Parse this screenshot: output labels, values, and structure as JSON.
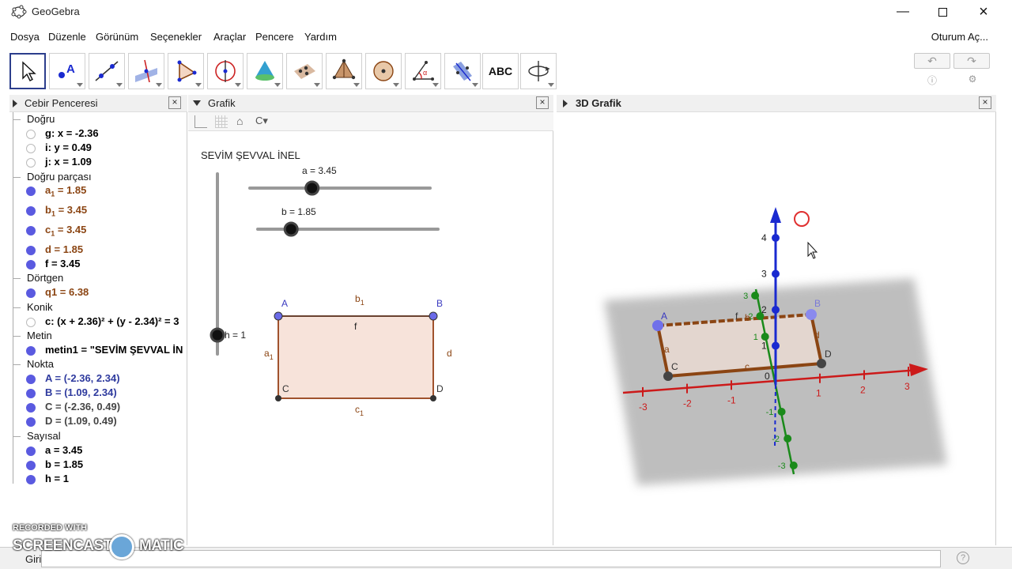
{
  "window": {
    "title": "GeoGebra",
    "min_icon": "minimize-icon",
    "max_icon": "maximize-icon",
    "close_icon": "close-icon"
  },
  "menu": {
    "items": [
      "Dosya",
      "Düzenle",
      "Görünüm",
      "Seçenekler",
      "Araçlar",
      "Pencere",
      "Yardım"
    ],
    "login": "Oturum Aç..."
  },
  "toolbar": {
    "tools": [
      "move-tool-icon",
      "point-tool-icon",
      "line-tool-icon",
      "perpendicular-tool-icon",
      "polygon-tool-icon",
      "circle-tool-icon",
      "cone-tool-icon",
      "plane-tool-icon",
      "pyramid-tool-icon",
      "sphere-tool-icon",
      "angle-tool-icon",
      "reflect-tool-icon",
      "text-tool-icon",
      "rotate-view-tool-icon"
    ],
    "text_tool_label": "ABC",
    "undo_icon": "undo-icon",
    "redo_icon": "redo-icon",
    "help_icon": "help-icon",
    "settings_icon": "gear-icon"
  },
  "algebra": {
    "title": "Cebir Penceresi",
    "rows": [
      {
        "type": "cat",
        "text": "Doğru"
      },
      {
        "type": "item",
        "text": "g: x = -2.36",
        "shown": false,
        "color": "#000000"
      },
      {
        "type": "item",
        "text": "i: y = 0.49",
        "shown": false,
        "color": "#000000"
      },
      {
        "type": "item",
        "text": "j: x = 1.09",
        "shown": false,
        "color": "#000000"
      },
      {
        "type": "cat",
        "text": "Doğru parçası"
      },
      {
        "type": "item",
        "name": "a",
        "sub": "1",
        "rest": " = 1.85",
        "shown": true,
        "color": "#8b4513"
      },
      {
        "type": "item",
        "name": "b",
        "sub": "1",
        "rest": " = 3.45",
        "shown": true,
        "color": "#8b4513"
      },
      {
        "type": "item",
        "name": "c",
        "sub": "1",
        "rest": " = 3.45",
        "shown": true,
        "color": "#8b4513"
      },
      {
        "type": "item",
        "text": "d = 1.85",
        "shown": true,
        "color": "#8b4513"
      },
      {
        "type": "item",
        "text": "f = 3.45",
        "shown": true,
        "color": "#000000"
      },
      {
        "type": "cat",
        "text": "Dörtgen"
      },
      {
        "type": "item",
        "text": "q1 = 6.38",
        "shown": true,
        "color": "#8b4513"
      },
      {
        "type": "cat",
        "text": "Konik"
      },
      {
        "type": "item",
        "text": "c: (x + 2.36)² + (y - 2.34)² = 3",
        "shown": false,
        "color": "#000000"
      },
      {
        "type": "cat",
        "text": "Metin"
      },
      {
        "type": "item",
        "text": "metin1 = \"SEVİM ŞEVVAL İN",
        "shown": true,
        "color": "#000000"
      },
      {
        "type": "cat",
        "text": "Nokta"
      },
      {
        "type": "item",
        "text": "A = (-2.36, 2.34)",
        "shown": true,
        "color": "#2e3a9e"
      },
      {
        "type": "item",
        "text": "B = (1.09, 2.34)",
        "shown": true,
        "color": "#2e3a9e"
      },
      {
        "type": "item",
        "text": "C = (-2.36, 0.49)",
        "shown": true,
        "color": "#444444"
      },
      {
        "type": "item",
        "text": "D = (1.09, 0.49)",
        "shown": true,
        "color": "#444444"
      },
      {
        "type": "cat",
        "text": "Sayısal"
      },
      {
        "type": "item",
        "text": "a = 3.45",
        "shown": true,
        "color": "#000000"
      },
      {
        "type": "item",
        "text": "b = 1.85",
        "shown": true,
        "color": "#000000"
      },
      {
        "type": "item",
        "text": "h = 1",
        "shown": true,
        "color": "#000000"
      }
    ]
  },
  "graphics": {
    "title": "Grafik",
    "text_label": "SEVİM ŞEVVAL İNEL",
    "slider_a": {
      "label": "a = 3.45",
      "value": 3.45,
      "min": 0,
      "max": 10
    },
    "slider_b": {
      "label": "b = 1.85",
      "value": 1.85,
      "min": 0,
      "max": 10
    },
    "slider_h": {
      "label": "h = 1",
      "value": 1
    },
    "points": {
      "A": "A",
      "B": "B",
      "C": "C",
      "D": "D"
    },
    "seg_labels": {
      "top": "b",
      "top_sub": "1",
      "bottom": "c",
      "bottom_sub": "1",
      "left": "a",
      "left_sub": "1",
      "right": "d",
      "mid": "f"
    }
  },
  "graphics3d": {
    "title": "3D Grafik",
    "x_ticks": [
      "-3",
      "-2",
      "-1",
      "0",
      "1",
      "2",
      "3"
    ],
    "z_ticks": [
      "1",
      "2",
      "3",
      "4"
    ],
    "y_ticks_pos": [
      "1",
      "2",
      "3"
    ],
    "y_ticks_neg": [
      "-1",
      "-2",
      "-3"
    ],
    "point_labels": [
      "A",
      "B",
      "C",
      "D"
    ],
    "seg_labels": [
      "a",
      "b",
      "c",
      "d",
      "f"
    ],
    "colors": {
      "x_axis": "#cc1a1a",
      "y_axis": "#1a8a1a",
      "z_axis": "#1a2ad0",
      "segment": "#8b4513",
      "point_blue": "#6a6ae8",
      "point_dark": "#444444"
    }
  },
  "input": {
    "label": "Giriş:",
    "help_icon": "help-icon"
  },
  "watermark": {
    "line1": "RECORDED WITH",
    "left": "SCREENCAST",
    "right": "MATIC"
  }
}
